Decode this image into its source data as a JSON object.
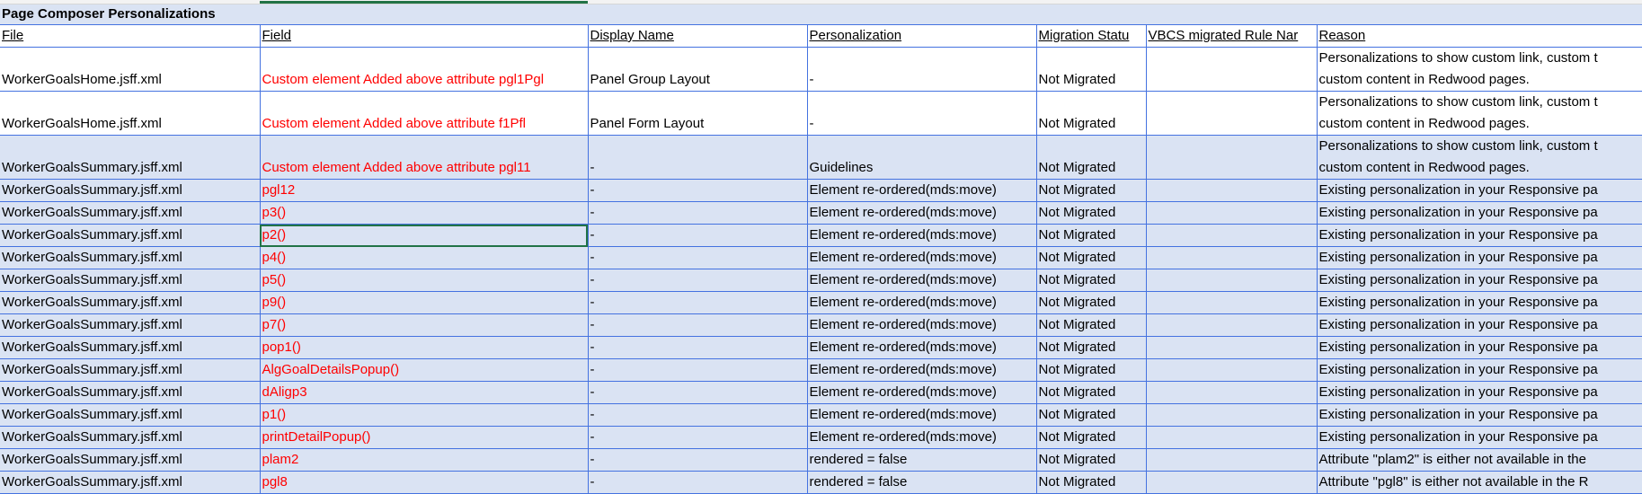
{
  "sheet": {
    "title": "Page Composer Personalizations",
    "columns": [
      "File",
      "Field",
      "Display Name",
      "Personalization",
      "Migration Statu",
      "VBCS migrated Rule Nar",
      "Reason"
    ],
    "rows": [
      {
        "file": "WorkerGoalsHome.jsff.xml",
        "field": "Custom element Added above attribute pgl1Pgl",
        "display": "Panel Group Layout",
        "personalization": "-",
        "status": "Not Migrated",
        "vbcs": "",
        "reason": "Personalizations to show custom link, custom t custom content in Redwood pages.",
        "tall": true,
        "blue": false
      },
      {
        "file": "WorkerGoalsHome.jsff.xml",
        "field": "Custom element Added above attribute f1Pfl",
        "display": "Panel Form Layout",
        "personalization": "-",
        "status": "Not Migrated",
        "vbcs": "",
        "reason": "Personalizations to show custom link, custom t custom content in Redwood pages.",
        "tall": true,
        "blue": false
      },
      {
        "file": "WorkerGoalsSummary.jsff.xml",
        "field": "Custom element Added above attribute pgl11",
        "display": "-",
        "personalization": "Guidelines",
        "status": "Not Migrated",
        "vbcs": "",
        "reason": "Personalizations to show custom link, custom t custom content in Redwood pages.",
        "tall": true,
        "blue": true
      },
      {
        "file": "WorkerGoalsSummary.jsff.xml",
        "field": "pgl12",
        "display": "-",
        "personalization": "Element re-ordered(mds:move)",
        "status": "Not Migrated",
        "vbcs": "",
        "reason": "Existing personalization in your Responsive pa",
        "blue": true
      },
      {
        "file": "WorkerGoalsSummary.jsff.xml",
        "field": "p3()",
        "display": "-",
        "personalization": "Element re-ordered(mds:move)",
        "status": "Not Migrated",
        "vbcs": "",
        "reason": "Existing personalization in your Responsive pa",
        "blue": true
      },
      {
        "file": "WorkerGoalsSummary.jsff.xml",
        "field": "p2()",
        "display": "-",
        "personalization": "Element re-ordered(mds:move)",
        "status": "Not Migrated",
        "vbcs": "",
        "reason": "Existing personalization in your Responsive pa",
        "blue": true,
        "selected": true
      },
      {
        "file": "WorkerGoalsSummary.jsff.xml",
        "field": "p4()",
        "display": "-",
        "personalization": "Element re-ordered(mds:move)",
        "status": "Not Migrated",
        "vbcs": "",
        "reason": "Existing personalization in your Responsive pa",
        "blue": true
      },
      {
        "file": "WorkerGoalsSummary.jsff.xml",
        "field": "p5()",
        "display": "-",
        "personalization": "Element re-ordered(mds:move)",
        "status": "Not Migrated",
        "vbcs": "",
        "reason": "Existing personalization in your Responsive pa",
        "blue": true
      },
      {
        "file": "WorkerGoalsSummary.jsff.xml",
        "field": "p9()",
        "display": "-",
        "personalization": "Element re-ordered(mds:move)",
        "status": "Not Migrated",
        "vbcs": "",
        "reason": "Existing personalization in your Responsive pa",
        "blue": true
      },
      {
        "file": "WorkerGoalsSummary.jsff.xml",
        "field": "p7()",
        "display": "-",
        "personalization": "Element re-ordered(mds:move)",
        "status": "Not Migrated",
        "vbcs": "",
        "reason": "Existing personalization in your Responsive pa",
        "blue": true
      },
      {
        "file": "WorkerGoalsSummary.jsff.xml",
        "field": "pop1()",
        "display": "-",
        "personalization": "Element re-ordered(mds:move)",
        "status": "Not Migrated",
        "vbcs": "",
        "reason": "Existing personalization in your Responsive pa",
        "blue": true
      },
      {
        "file": "WorkerGoalsSummary.jsff.xml",
        "field": "AlgGoalDetailsPopup()",
        "display": "-",
        "personalization": "Element re-ordered(mds:move)",
        "status": "Not Migrated",
        "vbcs": "",
        "reason": "Existing personalization in your Responsive pa",
        "blue": true
      },
      {
        "file": "WorkerGoalsSummary.jsff.xml",
        "field": "dAligp3",
        "display": "-",
        "personalization": "Element re-ordered(mds:move)",
        "status": "Not Migrated",
        "vbcs": "",
        "reason": "Existing personalization in your Responsive pa",
        "blue": true
      },
      {
        "file": "WorkerGoalsSummary.jsff.xml",
        "field": "p1()",
        "display": "-",
        "personalization": "Element re-ordered(mds:move)",
        "status": "Not Migrated",
        "vbcs": "",
        "reason": "Existing personalization in your Responsive pa",
        "blue": true
      },
      {
        "file": "WorkerGoalsSummary.jsff.xml",
        "field": "printDetailPopup()",
        "display": "-",
        "personalization": "Element re-ordered(mds:move)",
        "status": "Not Migrated",
        "vbcs": "",
        "reason": "Existing personalization in your Responsive pa",
        "blue": true
      },
      {
        "file": "WorkerGoalsSummary.jsff.xml",
        "field": "plam2",
        "display": "-",
        "personalization": "rendered = false",
        "status": "Not Migrated",
        "vbcs": "",
        "reason": "Attribute \"plam2\" is either not available in the",
        "blue": true
      },
      {
        "file": "WorkerGoalsSummary.jsff.xml",
        "field": "pgl8",
        "display": "-",
        "personalization": "rendered = false",
        "status": "Not Migrated",
        "vbcs": "",
        "reason": "Attribute \"pgl8\" is either not available in the R",
        "blue": true
      }
    ]
  },
  "colors": {
    "grid": "#4472e0",
    "band": "#dae3f3",
    "field_text": "#ff0000",
    "selection": "#217346"
  }
}
